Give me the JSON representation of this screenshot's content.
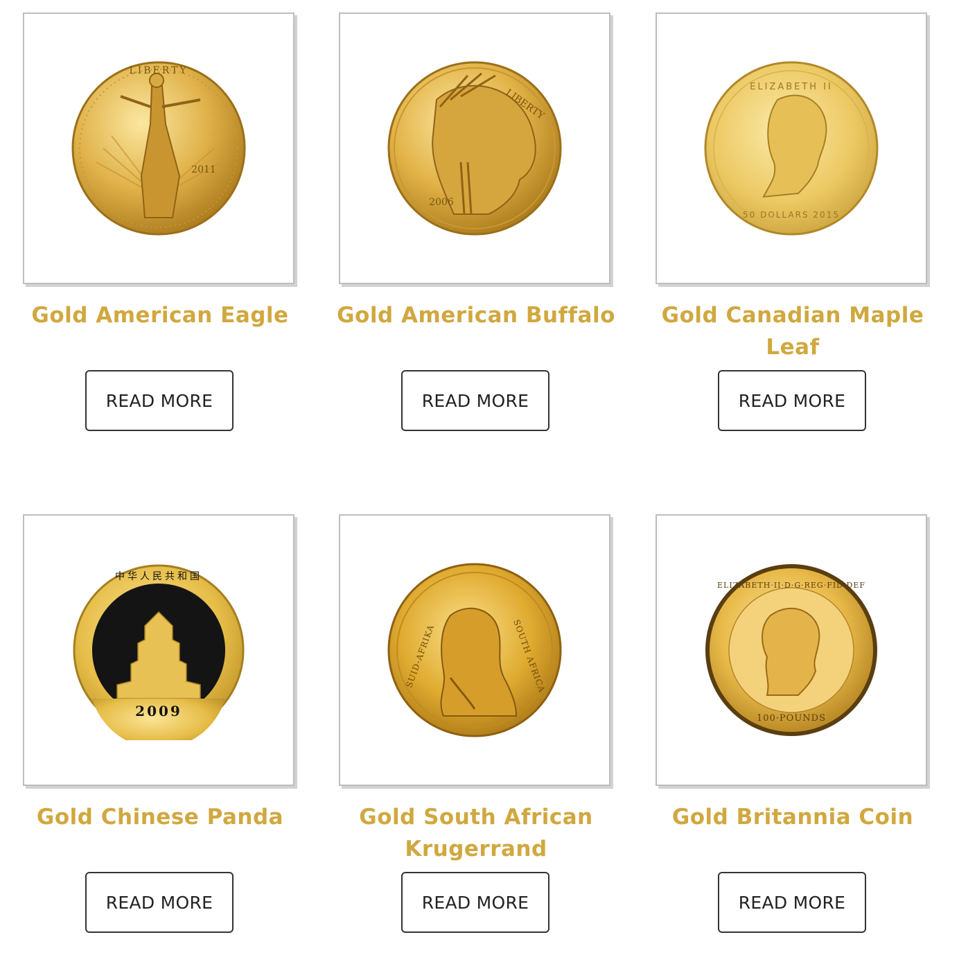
{
  "products": [
    {
      "title": "Gold American Eagle",
      "button_label": "READ MORE",
      "image": {
        "icon": "gold-american-eagle-coin-icon",
        "year": "2011",
        "legend": "LIBERTY"
      }
    },
    {
      "title": "Gold American Buffalo",
      "button_label": "READ MORE",
      "image": {
        "icon": "gold-american-buffalo-coin-icon",
        "year": "2006",
        "legend": "LIBERTY"
      }
    },
    {
      "title": "Gold Canadian Maple Leaf",
      "button_label": "READ MORE",
      "image": {
        "icon": "gold-canadian-maple-leaf-coin-icon",
        "top_legend": "ELIZABETH II",
        "bottom_legend": "50 DOLLARS 2015"
      }
    },
    {
      "title": "Gold Chinese Panda",
      "button_label": "READ MORE",
      "image": {
        "icon": "gold-chinese-panda-coin-icon",
        "year": "2009",
        "legend": "中华人民共和国"
      }
    },
    {
      "title": "Gold South African Krugerrand",
      "button_label": "READ MORE",
      "image": {
        "icon": "gold-krugerrand-coin-icon",
        "left_legend": "SUID-AFRIKA",
        "right_legend": "SOUTH AFRICA"
      }
    },
    {
      "title": "Gold Britannia Coin",
      "button_label": "READ MORE",
      "image": {
        "icon": "gold-britannia-coin-icon",
        "top_legend": "ELIZABETH·II·D·G·REG·FID·DEF",
        "bottom_legend": "100·POUNDS"
      }
    }
  ],
  "colors": {
    "title_gold": "#d0a83f",
    "coin_light": "#f4d77a",
    "coin_mid": "#dcae3c",
    "coin_dark": "#a87a1c",
    "button_border": "#333333"
  }
}
